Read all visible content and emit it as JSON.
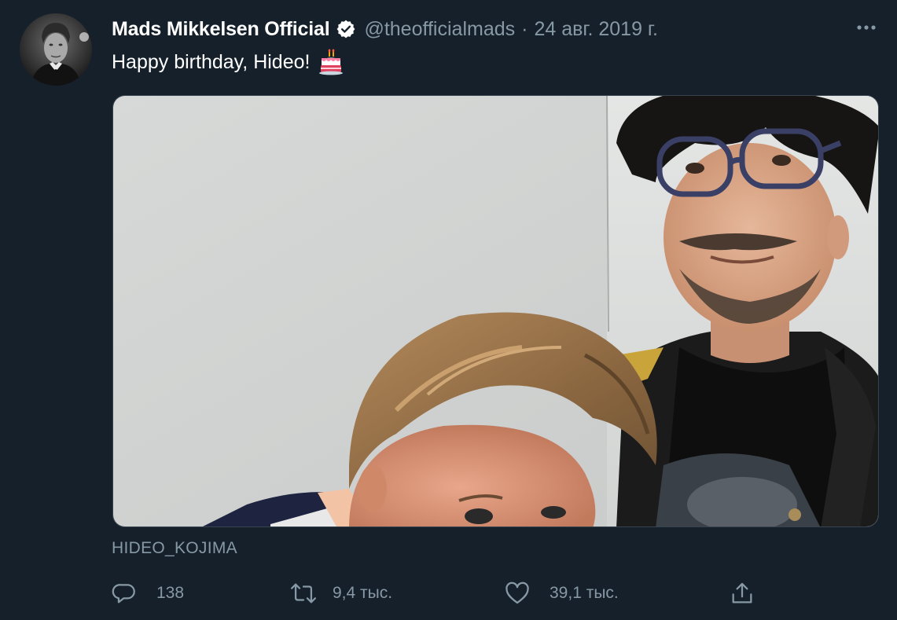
{
  "author": {
    "display_name": "Mads Mikkelsen Official",
    "verified": true,
    "handle": "@theofficialmads",
    "separator": "·",
    "date": "24 авг. 2019 г."
  },
  "tweet": {
    "text": "Happy birthday, Hideo!",
    "emoji": "birthday-cake-emoji"
  },
  "media": {
    "alt_caption": "HIDEO_KOJIMA"
  },
  "actions": {
    "reply_count": "138",
    "retweet_count": "9,4 тыс.",
    "like_count": "39,1 тыс."
  },
  "colors": {
    "background": "#15202b",
    "secondary_text": "#8899a6",
    "primary_text": "#ffffff",
    "verified_badge": "#ffffff"
  }
}
